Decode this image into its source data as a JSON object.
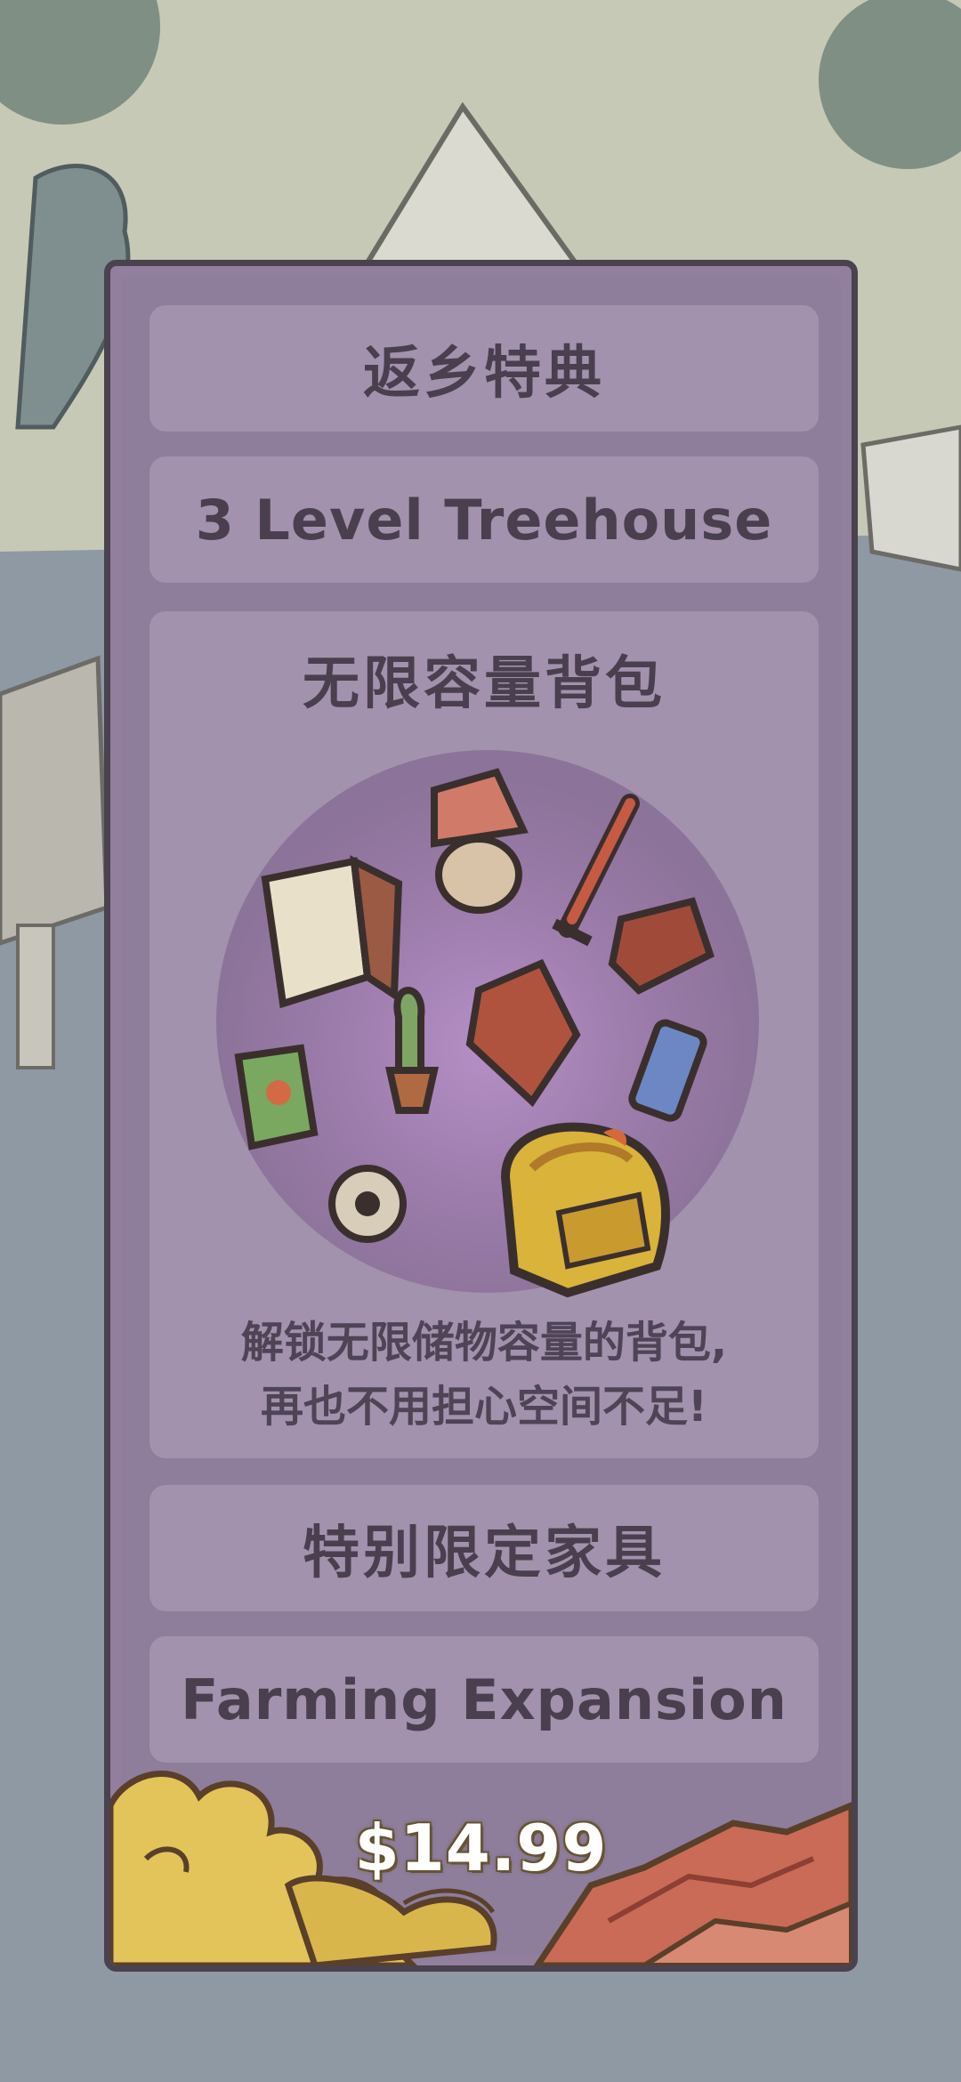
{
  "offer": {
    "rows": [
      {
        "label": "返乡特典"
      },
      {
        "label": "3 Level Treehouse"
      },
      {
        "label": "无限容量背包"
      },
      {
        "label": "特别限定家具"
      },
      {
        "label": "Farming Expansion"
      }
    ],
    "feature_description_lines": [
      "解锁无限储物容量的背包,",
      "再也不用担心空间不足!"
    ],
    "price": "$14.99"
  },
  "icons": [
    "lamp-icon",
    "sword-icon",
    "table-icon",
    "cabinet-icon",
    "slingshot-icon",
    "cactus-icon",
    "book-icon",
    "phone-icon",
    "ring-icon",
    "backpack-icon",
    "cloud-wave-icon",
    "mountain-icon"
  ],
  "colors": {
    "panel": "#917f9d",
    "row": "#a292ad",
    "text": "#4a3f4f",
    "price": "#ffffff"
  }
}
